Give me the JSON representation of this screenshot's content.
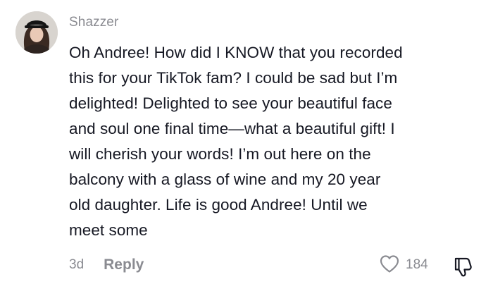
{
  "comment": {
    "username": "Shazzer",
    "avatar_icon": "user-avatar",
    "text": "Oh Andree! How did I KNOW that you recorded\nthis for your TikTok fam? I could be sad but I’m\ndelighted! Delighted to see your beautiful face\nand soul one final time—what a beautiful gift! I\nwill cherish your words! I’m out here on the\nbalcony with a glass of wine and my 20 year\nold daughter. Life is good Andree! Until we\nmeet some",
    "timestamp": "3d",
    "reply_label": "Reply",
    "like_icon": "heart-outline-icon",
    "like_count": "184",
    "dislike_icon": "thumbs-down-icon"
  },
  "colors": {
    "text": "#161823",
    "secondary": "#8a8b91",
    "background": "#ffffff"
  }
}
